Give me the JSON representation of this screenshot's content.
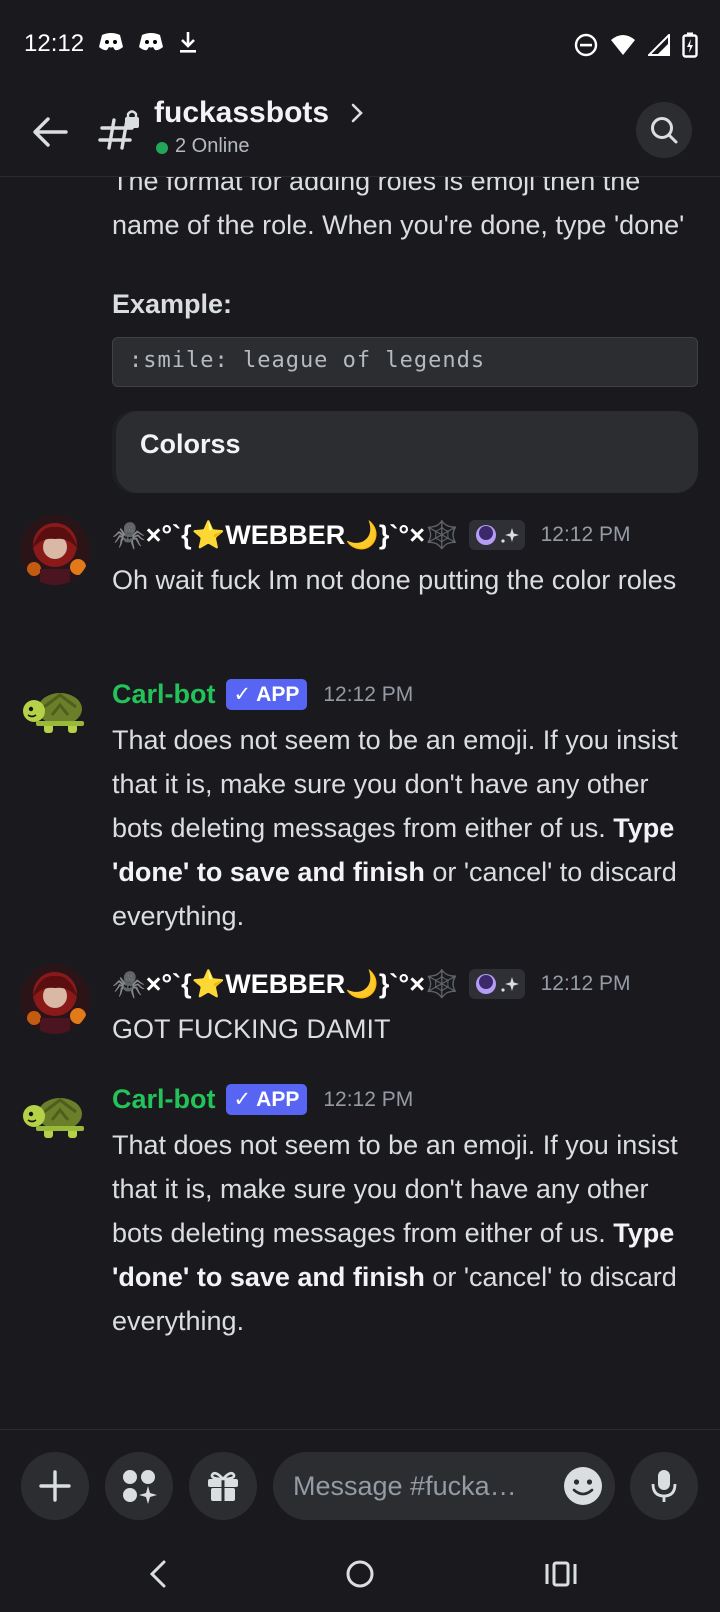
{
  "status": {
    "time": "12:12"
  },
  "header": {
    "channel_name": "fuckassbots",
    "online": "2 Online"
  },
  "intro": {
    "text": "The format for adding roles is emoji then the name of the role. When you're done, type 'done'",
    "example_label": "Example:",
    "example_code": ":smile: league of legends",
    "embed_title": "Colorss"
  },
  "messages": [
    {
      "author": "🕷️×°`{⭐WEBBER🌙}`°×🕸️",
      "time": "12:12 PM",
      "text": "Oh wait fuck Im not done putting the color roles"
    },
    {
      "author": "Carl-bot",
      "badge": "✓ APP",
      "time": "12:12 PM",
      "text_plain": "That does not seem to be an emoji. If you insist that it is, make sure you don't have any other bots deleting messages from either of us. ",
      "text_bold": "Type 'done' to save and finish",
      "text_end": " or 'cancel' to discard everything."
    },
    {
      "author": "🕷️×°`{⭐WEBBER🌙}`°×🕸️",
      "time": "12:12 PM",
      "text": "GOT FUCKING DAMIT"
    },
    {
      "author": "Carl-bot",
      "badge": "✓ APP",
      "time": "12:12 PM",
      "text_plain": "That does not seem to be an emoji. If you insist that it is, make sure you don't have any other bots deleting messages from either of us. ",
      "text_bold": "Type 'done' to save and finish",
      "text_end": " or 'cancel' to discard everything."
    }
  ],
  "composer": {
    "placeholder": "Message #fucka…"
  },
  "colors": {
    "accent": "#5865f2",
    "bot_name": "#23c35a",
    "online": "#23a55a",
    "background": "#1a1a1e"
  }
}
